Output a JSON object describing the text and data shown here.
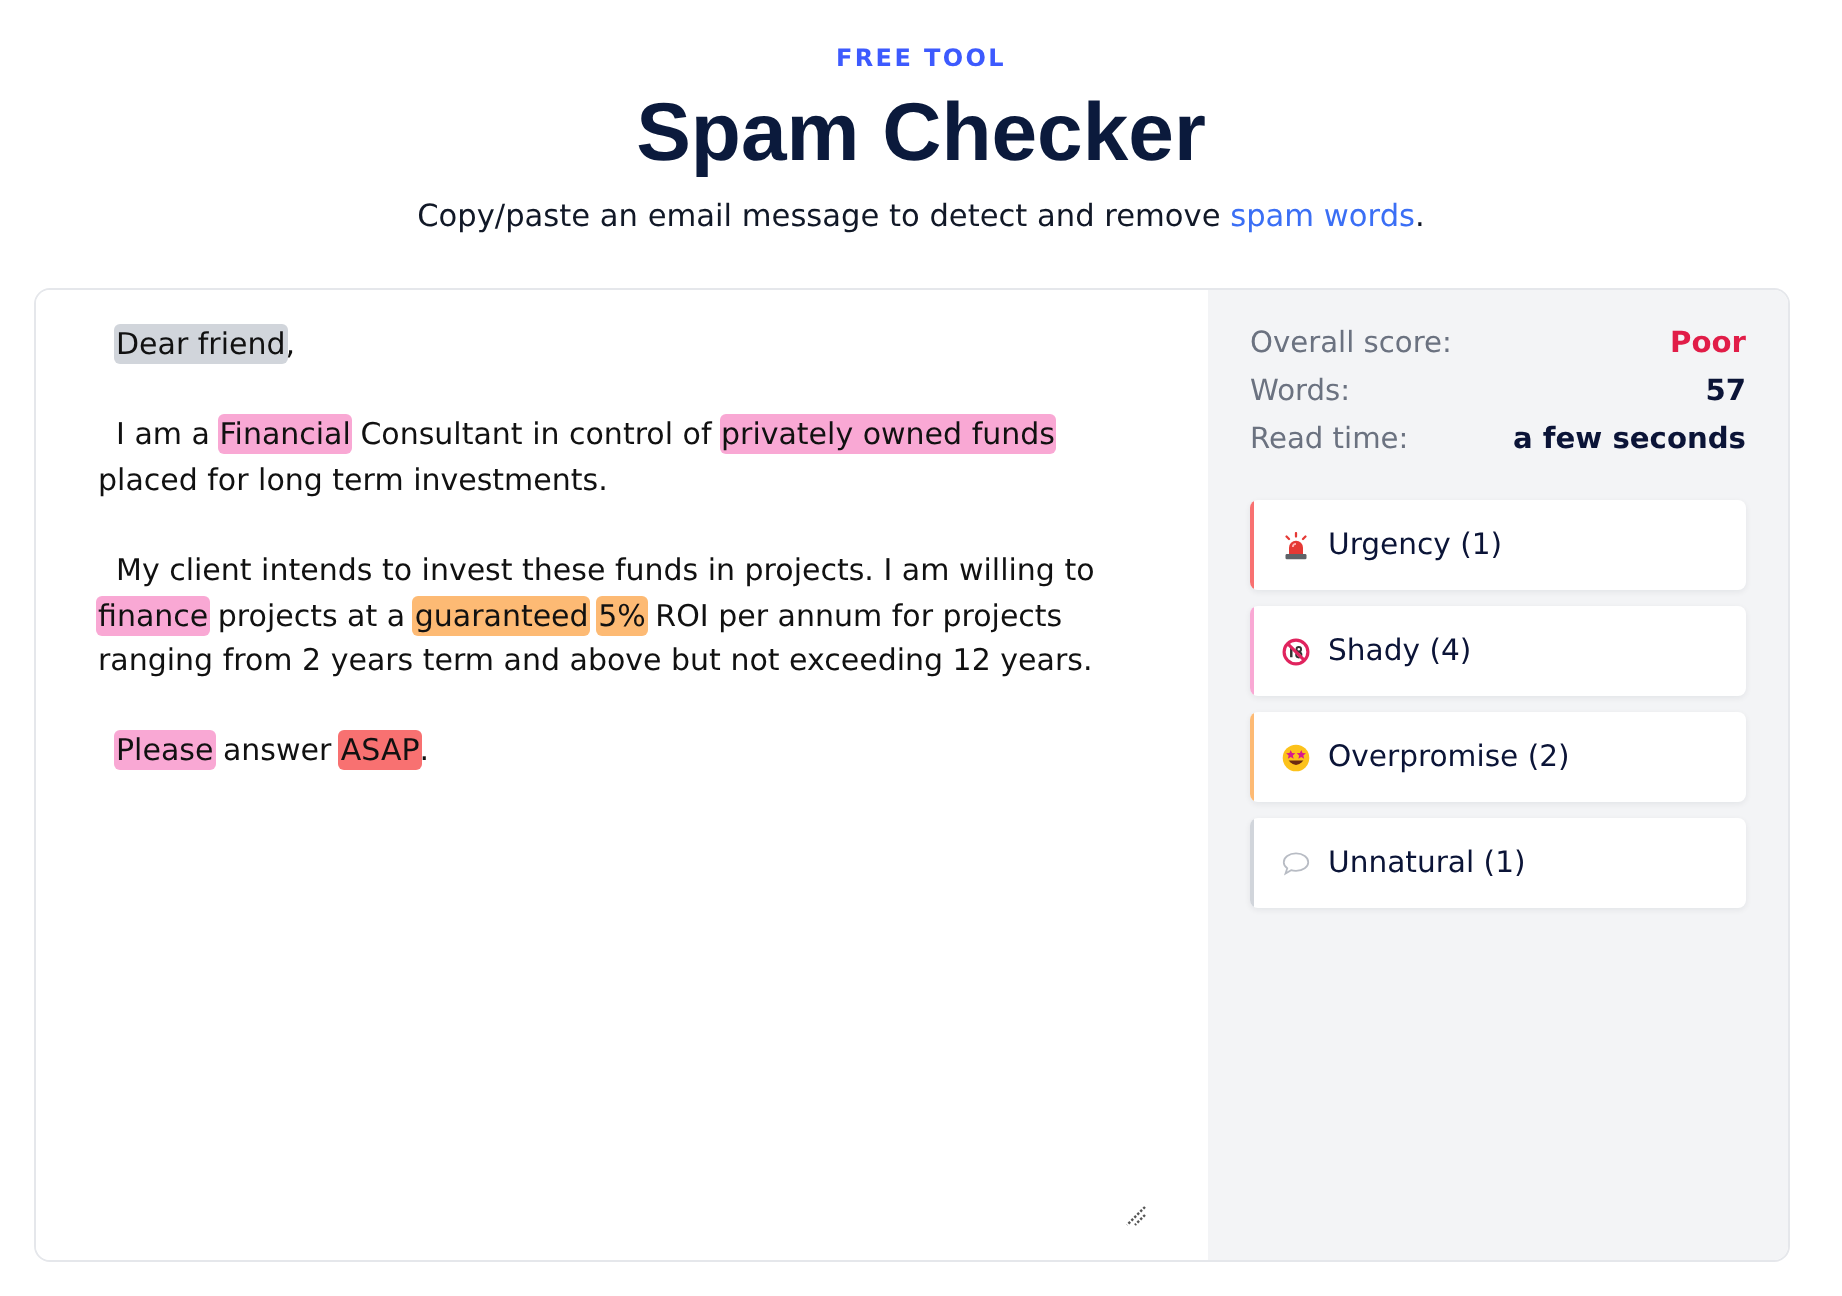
{
  "header": {
    "eyebrow": "FREE TOOL",
    "title": "Spam Checker",
    "subtitle": {
      "text": "Copy/paste an email message to detect and remove ",
      "link": "spam words",
      "end": "."
    }
  },
  "editor": {
    "paragraphs": [
      {
        "segments": [
          {
            "text": "Dear friend",
            "color": "#d1d5db"
          },
          {
            "text": ","
          }
        ]
      },
      {
        "segments": [
          {
            "text": "I am a "
          },
          {
            "text": "Financial",
            "color": "#f9a8d4"
          },
          {
            "text": " Consultant in control of "
          },
          {
            "text": "privately owned funds",
            "color": "#f9a8d4"
          },
          {
            "text": " placed for long term investments."
          }
        ]
      },
      {
        "segments": [
          {
            "text": "My client intends to invest these funds in projects. I am willing to "
          },
          {
            "text": "finance",
            "color": "#f9a8d4"
          },
          {
            "text": " projects at a "
          },
          {
            "text": "guaranteed",
            "color": "#fdba74"
          },
          {
            "text": "5%",
            "color": "#fdba74"
          },
          {
            "text": " ROI per annum for projects ranging from 2 years term and above but not exceeding 12 years."
          }
        ]
      },
      {
        "segments": [
          {
            "text": "Please",
            "color": "#f9a8d4"
          },
          {
            "text": " answer "
          },
          {
            "text": "ASAP",
            "color": "#f87171"
          },
          {
            "text": "."
          }
        ]
      }
    ]
  },
  "stats": [
    {
      "label": "Overall score:",
      "value": "Poor",
      "color": "#e11d48"
    },
    {
      "label": "Words:",
      "value": "57",
      "color": "#0b1437"
    },
    {
      "label": "Read time:",
      "value": "a few seconds",
      "color": "#0b1437"
    }
  ],
  "categories": [
    {
      "kind": "urgency",
      "label": "Urgency (1)",
      "color": "#f87171"
    },
    {
      "kind": "shady",
      "label": "Shady (4)",
      "color": "#f9a8d4"
    },
    {
      "kind": "overpromise",
      "label": "Overpromise (2)",
      "color": "#fdba74"
    },
    {
      "kind": "unnatural",
      "label": "Unnatural (1)",
      "color": "#d1d5db"
    }
  ]
}
